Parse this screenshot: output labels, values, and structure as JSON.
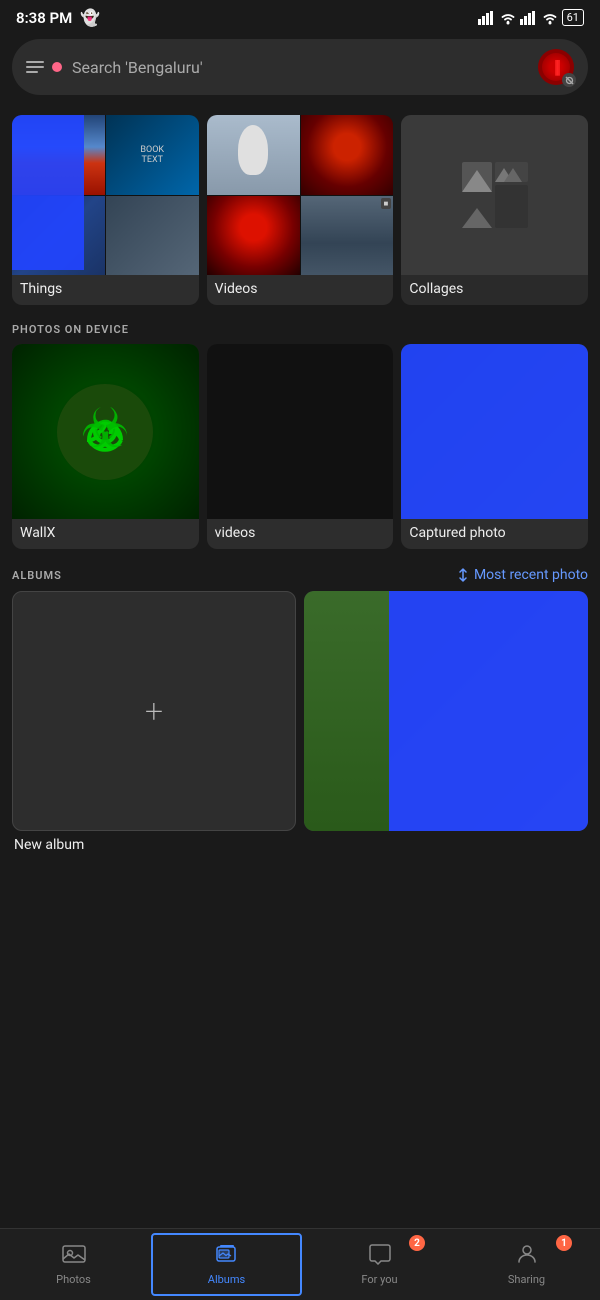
{
  "statusBar": {
    "time": "8:38 PM",
    "battery": "61"
  },
  "search": {
    "placeholder": "Search 'Bengaluru'"
  },
  "libraryItems": [
    {
      "id": "things",
      "label": "Things"
    },
    {
      "id": "videos",
      "label": "Videos"
    },
    {
      "id": "collages",
      "label": "Collages"
    }
  ],
  "sections": {
    "photosOnDevice": "PHOTOS ON DEVICE",
    "albums": "ALBUMS"
  },
  "deviceItems": [
    {
      "id": "wallx",
      "label": "WallX"
    },
    {
      "id": "videos-folder",
      "label": "videos"
    },
    {
      "id": "captured-photo",
      "label": "Captured photo"
    }
  ],
  "albumsSort": "Most recent photo",
  "albums": [
    {
      "id": "new-album",
      "label": "New album"
    },
    {
      "id": "album-2",
      "label": ""
    }
  ],
  "bottomNav": {
    "items": [
      {
        "id": "photos",
        "label": "Photos",
        "icon": "🖼",
        "badge": null,
        "active": false
      },
      {
        "id": "albums",
        "label": "Albums",
        "icon": "📒",
        "badge": null,
        "active": true
      },
      {
        "id": "for-you",
        "label": "For you",
        "icon": "💬",
        "badge": "2",
        "active": false
      },
      {
        "id": "sharing",
        "label": "Sharing",
        "icon": "👤",
        "badge": "1",
        "active": false
      }
    ]
  }
}
